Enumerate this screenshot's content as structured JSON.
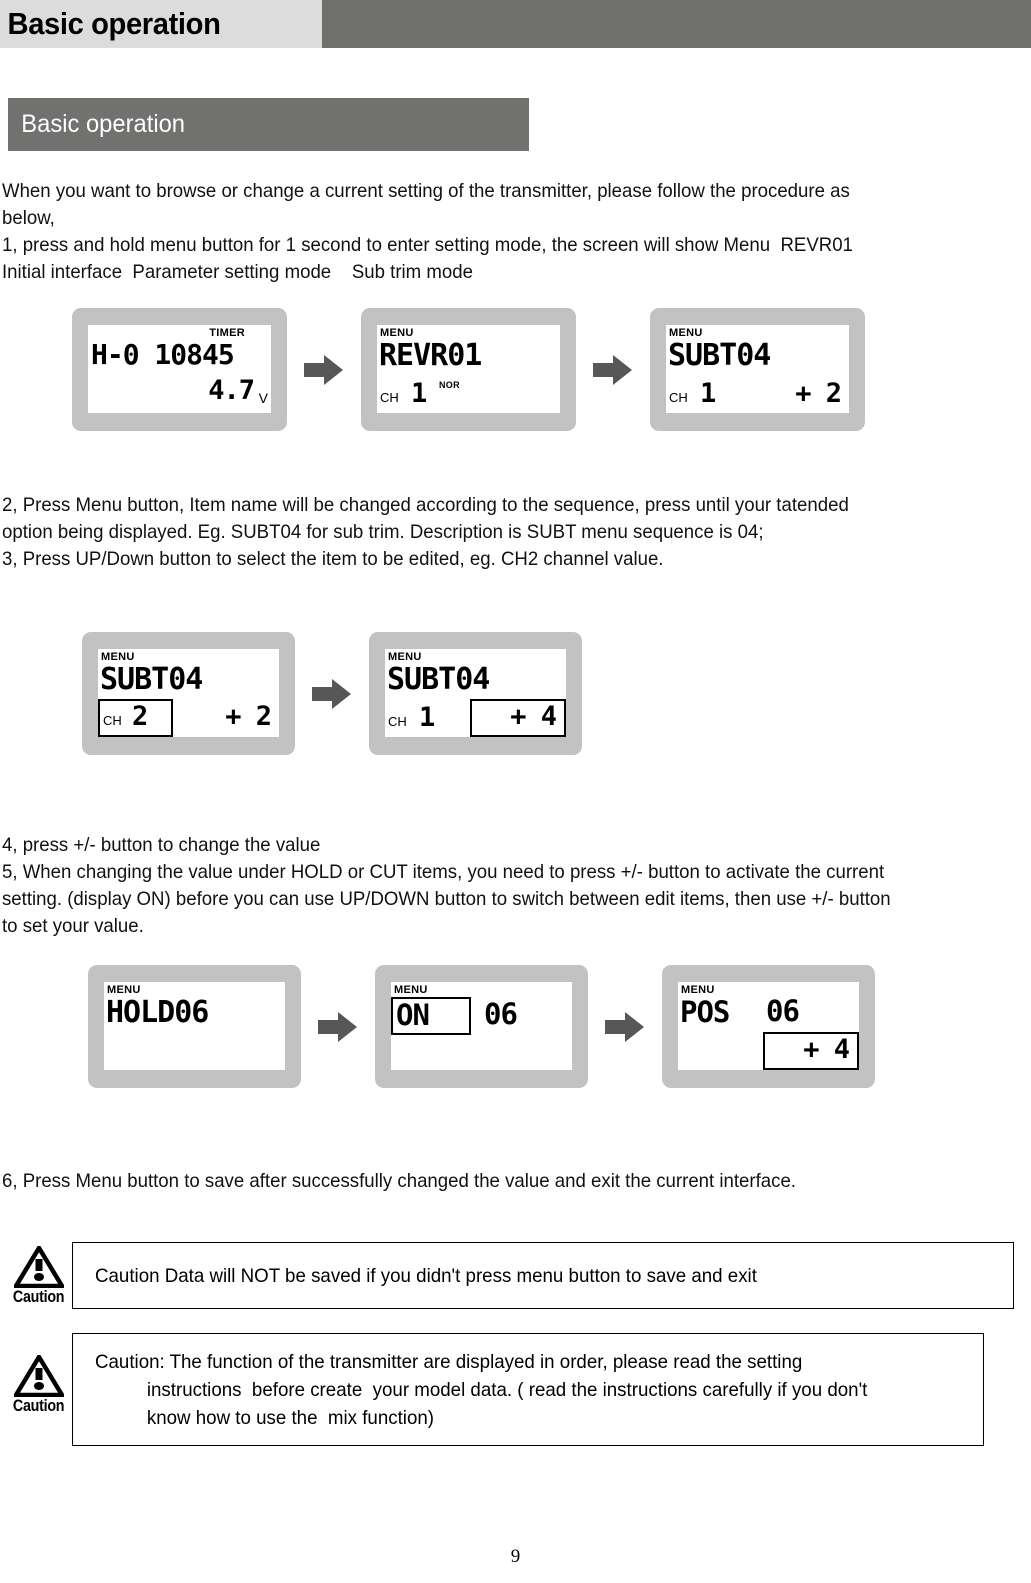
{
  "header": {
    "title": "Basic operation"
  },
  "section": {
    "label": "Basic operation"
  },
  "paragraphs": {
    "intro": [
      "When you want to browse or change a current setting of the transmitter, please follow the procedure as",
      "below,",
      "1, press and hold menu button for 1 second to enter setting mode, the screen will show Menu  REVR01",
      "Initial interface  Parameter setting mode    Sub trim mode"
    ],
    "step23": [
      "2, Press Menu button, Item name will be changed according to the sequence, press until your tatended",
      "option being displayed. Eg. SUBT04 for sub trim. Description is SUBT menu sequence is 04;",
      "3, Press UP/Down button to select the item to be edited, eg. CH2 channel value."
    ],
    "step45": [
      "4, press +/- button to change the value",
      "5, When changing the value under HOLD or CUT items, you need to press +/- button to activate the current",
      "setting. (display ON) before you can use UP/DOWN button to switch between edit items, then use +/- button",
      "to set your value."
    ],
    "step6": [
      "6, Press Menu button to save after successfully changed the value and exit the current interface."
    ]
  },
  "lcd_rows": [
    {
      "name": "row-initial-to-subtrim",
      "screens": [
        {
          "id": "lcd-timer",
          "tag": "TIMER",
          "main": "H-0 10845",
          "sub": "4.7",
          "sub_unit": "V",
          "ch_label": "",
          "ch_value": "",
          "mode_label": "",
          "highlight": "none"
        },
        {
          "id": "lcd-revr01",
          "tag": "MENU",
          "main": "REVR01",
          "sub": "",
          "sub_unit": "",
          "ch_label": "CH",
          "ch_value": "1",
          "mode_label": "NOR",
          "highlight": "none"
        },
        {
          "id": "lcd-subt04-ch1-plus2",
          "tag": "MENU",
          "main": "SUBT04",
          "sub": "+  2",
          "sub_unit": "",
          "ch_label": "CH",
          "ch_value": "1",
          "mode_label": "",
          "highlight": "none"
        }
      ]
    },
    {
      "name": "row-select-item",
      "screens": [
        {
          "id": "lcd-subt04-ch2-plus2",
          "tag": "MENU",
          "main": "SUBT04",
          "sub": "+  2",
          "sub_unit": "",
          "ch_label": "CH",
          "ch_value": "2",
          "mode_label": "",
          "highlight": "channel"
        },
        {
          "id": "lcd-subt04-ch1-plus4",
          "tag": "MENU",
          "main": "SUBT04",
          "sub": "+  4",
          "sub_unit": "",
          "ch_label": "CH",
          "ch_value": "1",
          "mode_label": "",
          "highlight": "value"
        }
      ]
    },
    {
      "name": "row-hold-sequence",
      "screens": [
        {
          "id": "lcd-hold06",
          "tag": "MENU",
          "main": "HOLD06",
          "sub": "",
          "sub_unit": "",
          "ch_label": "",
          "ch_value": "",
          "mode_label": "",
          "highlight": "none"
        },
        {
          "id": "lcd-on-06",
          "tag": "MENU",
          "main_left": "ON",
          "main_right": "06",
          "sub": "",
          "sub_unit": "",
          "highlight": "on-state"
        },
        {
          "id": "lcd-pos-06",
          "tag": "MENU",
          "main_left": "POS",
          "main_right": "06",
          "sub": "+  4",
          "sub_unit": "",
          "highlight": "value"
        }
      ]
    }
  ],
  "arrows": {
    "icon": "right-arrow-icon",
    "color": "#575755"
  },
  "cautions": [
    {
      "id": "caution-save",
      "icon_label": "Caution",
      "lines": [
        {
          "text": "Caution Data will NOT be saved if you didn't press menu button to save and exit",
          "indent": false
        }
      ]
    },
    {
      "id": "caution-order",
      "icon_label": "Caution",
      "lines": [
        {
          "text": "Caution: The function of the transmitter are displayed in order, please read the setting",
          "indent": false
        },
        {
          "text": "instructions  before create  your model data. ( read the instructions carefully if you don't",
          "indent": true
        },
        {
          "text": "know how to use the  mix function)",
          "indent": true
        }
      ]
    }
  ],
  "footer": {
    "page_number": "9"
  },
  "colors": {
    "header_bar": "#6f6f6d",
    "header_title_bg": "#dcdcdc",
    "section_bar": "#717170",
    "lcd_bezel": "#c2c2c2",
    "lcd_screen": "#ffffff",
    "arrow": "#575755"
  }
}
